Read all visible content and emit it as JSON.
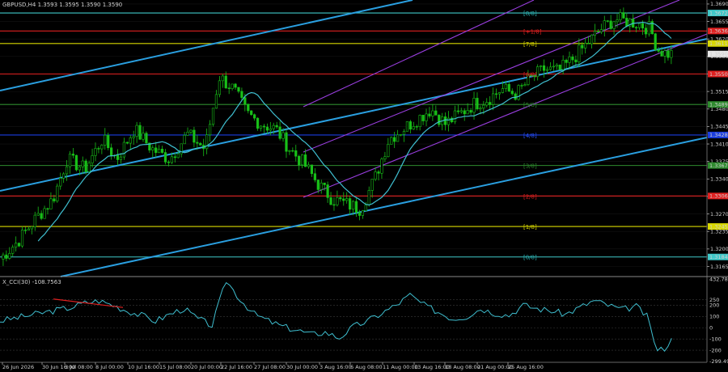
{
  "header": {
    "main_title": "GBPUSD,H4  1.3593 1.3595 1.3590 1.3590",
    "indicator_title": "X_CCI(30) -108.7563"
  },
  "chart_data": {
    "type": "candlestick",
    "symbol": "GBPUSD",
    "timeframe": "H4",
    "ohlc": [
      1.3593,
      1.3595,
      1.359,
      1.359
    ],
    "ylim": [
      1.3148,
      1.3698
    ],
    "price_ticks": [
      "1.3690",
      "1.3655",
      "1.3620",
      "1.3585",
      "1.3550",
      "1.3515",
      "1.3480",
      "1.3445",
      "1.3410",
      "1.3375",
      "1.3340",
      "1.3305",
      "1.3270",
      "1.3235",
      "1.3200",
      "1.3165"
    ],
    "x_tick_labels": [
      "26 Jun 2026",
      "30 Jun 16:00",
      "3 Jul 08:00",
      "8 Jul 00:00",
      "10 Jul 16:00",
      "15 Jul 08:00",
      "20 Jul 00:00",
      "22 Jul 16:00",
      "27 Jul 08:00",
      "30 Jul 00:00",
      "3 Aug 16:00",
      "6 Aug 08:00",
      "11 Aug 00:00",
      "13 Aug 16:00",
      "18 Aug 08:00",
      "21 Aug 00:00",
      "25 Aug 16:00"
    ],
    "close_path": [
      [
        0,
        1.318
      ],
      [
        5,
        1.3215
      ],
      [
        10,
        1.326
      ],
      [
        15,
        1.33
      ],
      [
        19,
        1.338
      ],
      [
        24,
        1.336
      ],
      [
        29,
        1.342
      ],
      [
        33,
        1.338
      ],
      [
        38,
        1.344
      ],
      [
        43,
        1.34
      ],
      [
        48,
        1.338
      ],
      [
        53,
        1.343
      ],
      [
        58,
        1.34
      ],
      [
        62,
        1.3545
      ],
      [
        66,
        1.352
      ],
      [
        70,
        1.347
      ],
      [
        74,
        1.345
      ],
      [
        78,
        1.344
      ],
      [
        82,
        1.34
      ],
      [
        86,
        1.337
      ],
      [
        90,
        1.333
      ],
      [
        94,
        1.33
      ],
      [
        98,
        1.329
      ],
      [
        102,
        1.328
      ],
      [
        106,
        1.334
      ],
      [
        110,
        1.342
      ],
      [
        114,
        1.344
      ],
      [
        118,
        1.346
      ],
      [
        122,
        1.348
      ],
      [
        126,
        1.345
      ],
      [
        130,
        1.347
      ],
      [
        134,
        1.349
      ],
      [
        138,
        1.35
      ],
      [
        142,
        1.352
      ],
      [
        146,
        1.351
      ],
      [
        150,
        1.354
      ],
      [
        154,
        1.356
      ],
      [
        158,
        1.3555
      ],
      [
        162,
        1.358
      ],
      [
        166,
        1.361
      ],
      [
        170,
        1.364
      ],
      [
        174,
        1.366
      ],
      [
        178,
        1.3655
      ],
      [
        181,
        1.365
      ],
      [
        184,
        1.364
      ],
      [
        186,
        1.36
      ],
      [
        188,
        1.3592
      ],
      [
        190,
        1.359
      ]
    ],
    "horizontal_levels": [
      {
        "label": "8/8",
        "price": 1.3672,
        "color": "#3fc7c7",
        "label_color": "#2ab6b6"
      },
      {
        "label": "+1/8",
        "price": 1.3636,
        "color": "#e02020",
        "label_color": "#e02020"
      },
      {
        "label": "7/8",
        "price": 1.3611,
        "color": "#d8d800",
        "label_color": "#d8d800"
      },
      {
        "label": "6/8",
        "price": 1.355,
        "color": "#e02020",
        "label_color": "#e02020"
      },
      {
        "label": "5/8",
        "price": 1.3489,
        "color": "#2e8b2e",
        "label_color": "#2e8b2e"
      },
      {
        "label": "4/8",
        "price": 1.3428,
        "color": "#1a3de0",
        "label_color": "#2a52ff"
      },
      {
        "label": "3/8",
        "price": 1.3367,
        "color": "#2e8b2e",
        "label_color": "#2e8b2e"
      },
      {
        "label": "2/8",
        "price": 1.3306,
        "color": "#e02020",
        "label_color": "#e02020"
      },
      {
        "label": "1/8",
        "price": 1.3245,
        "color": "#d8d800",
        "label_color": "#d8d800"
      },
      {
        "label": "0/8",
        "price": 1.3184,
        "color": "#3fc7c7",
        "label_color": "#2ab6b6"
      }
    ],
    "level_price_boxes": [
      "1.3672",
      "1.3636",
      "1.3611",
      "1.3550",
      "1.3489",
      "1.3428",
      "1.3367",
      "1.3306",
      "1.3245",
      "1.3184"
    ],
    "current_price": "1.3590",
    "oscillator": {
      "name": "X_CCI(30)",
      "value": -108.7563,
      "ylim": [
        -300,
        433
      ],
      "ticks": [
        "432.786",
        "250",
        "200",
        "100",
        "0",
        "-100",
        "-200",
        "-299.497"
      ],
      "levels": [
        250,
        200,
        100,
        0,
        -100,
        -200
      ],
      "series": [
        [
          0,
          60
        ],
        [
          5,
          90
        ],
        [
          10,
          120
        ],
        [
          15,
          150
        ],
        [
          20,
          180
        ],
        [
          24,
          220
        ],
        [
          28,
          240
        ],
        [
          32,
          200
        ],
        [
          36,
          150
        ],
        [
          40,
          110
        ],
        [
          44,
          60
        ],
        [
          48,
          120
        ],
        [
          52,
          170
        ],
        [
          56,
          80
        ],
        [
          60,
          20
        ],
        [
          64,
          420
        ],
        [
          68,
          250
        ],
        [
          72,
          120
        ],
        [
          76,
          60
        ],
        [
          80,
          10
        ],
        [
          84,
          -20
        ],
        [
          88,
          -60
        ],
        [
          92,
          -40
        ],
        [
          96,
          -90
        ],
        [
          100,
          10
        ],
        [
          104,
          60
        ],
        [
          108,
          130
        ],
        [
          112,
          200
        ],
        [
          116,
          290
        ],
        [
          120,
          200
        ],
        [
          124,
          140
        ],
        [
          128,
          80
        ],
        [
          132,
          100
        ],
        [
          136,
          170
        ],
        [
          140,
          130
        ],
        [
          144,
          110
        ],
        [
          148,
          200
        ],
        [
          152,
          170
        ],
        [
          156,
          150
        ],
        [
          160,
          120
        ],
        [
          164,
          180
        ],
        [
          168,
          240
        ],
        [
          172,
          200
        ],
        [
          176,
          160
        ],
        [
          180,
          190
        ],
        [
          183,
          100
        ],
        [
          186,
          -210
        ],
        [
          188,
          -180
        ],
        [
          190,
          -108
        ]
      ]
    }
  }
}
